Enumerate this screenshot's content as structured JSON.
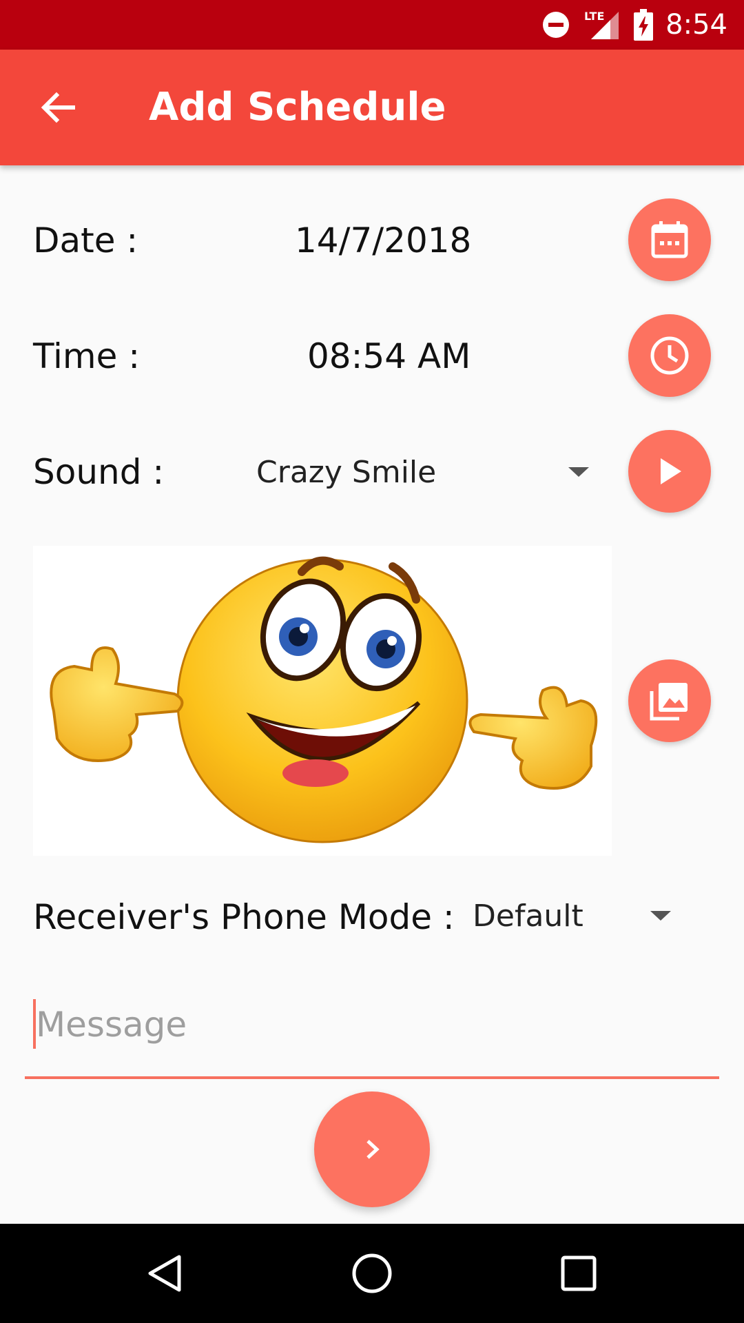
{
  "status_bar": {
    "time": "8:54",
    "network": "LTE",
    "icons": [
      "do-not-disturb-icon",
      "signal-icon",
      "battery-charging-icon"
    ]
  },
  "app_bar": {
    "title": "Add Schedule",
    "back_icon": "arrow-back-icon"
  },
  "form": {
    "date": {
      "label": "Date :",
      "value": "14/7/2018",
      "button_icon": "calendar-icon"
    },
    "time": {
      "label": "Time :",
      "value": "08:54 AM",
      "button_icon": "clock-icon"
    },
    "sound": {
      "label": "Sound :",
      "value": "Crazy Smile",
      "button_icon": "play-icon"
    },
    "image": {
      "button_icon": "gallery-icon",
      "subject": "smiley-emoji"
    },
    "phone_mode": {
      "label": "Receiver's Phone Mode :",
      "value": "Default"
    },
    "message": {
      "placeholder": "Message",
      "value": ""
    },
    "next_icon": "chevron-right-icon"
  },
  "nav_bar": {
    "buttons": [
      "back-triangle-icon",
      "home-circle-icon",
      "recents-square-icon"
    ]
  },
  "colors": {
    "status_bar": "#b9000e",
    "app_bar": "#f3473b",
    "accent": "#fd7260",
    "background": "#fafafa"
  }
}
